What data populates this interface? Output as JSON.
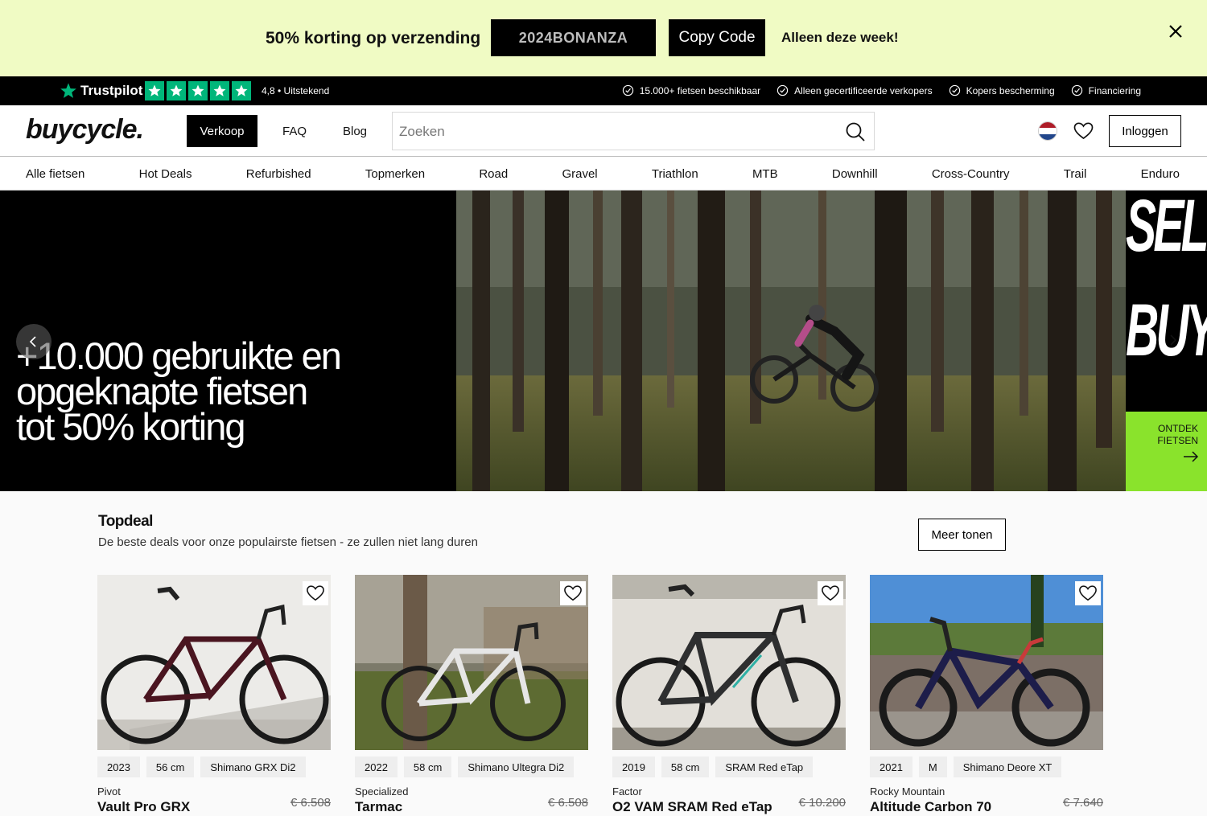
{
  "promo": {
    "text": "50% korting op verzending",
    "code": "2024BONANZA",
    "copy_label": "Copy Code",
    "note": "Alleen deze week!"
  },
  "trustbar": {
    "trustpilot_label": "Trustpilot",
    "rating": "4,8 • Uitstekend",
    "usps": [
      "15.000+ fietsen beschikbaar",
      "Alleen gecertificeerde verkopers",
      "Kopers bescherming",
      "Financiering"
    ]
  },
  "header": {
    "logo": "buycycle.",
    "nav": {
      "sell": "Verkoop",
      "faq": "FAQ",
      "blog": "Blog"
    },
    "search_placeholder": "Zoeken",
    "login": "Inloggen"
  },
  "categories": [
    "Alle fietsen",
    "Hot Deals",
    "Refurbished",
    "Topmerken",
    "Road",
    "Gravel",
    "Triathlon",
    "MTB",
    "Downhill",
    "Cross-Country",
    "Trail",
    "Enduro"
  ],
  "hero": {
    "headline": [
      "+10.000 gebruikte en",
      "opgeknapte fietsen",
      "tot 50% korting"
    ],
    "side_words": [
      "SELL",
      "BUY"
    ],
    "cta": [
      "ONTDEK",
      "FIETSEN"
    ]
  },
  "topdeal": {
    "title": "Topdeal",
    "subtitle": "De beste deals voor onze populairste fietsen - ze zullen niet lang duren",
    "more_label": "Meer tonen",
    "cards": [
      {
        "tags": [
          "2023",
          "56 cm",
          "Shimano GRX Di2"
        ],
        "brand": "Pivot",
        "model": "Vault Pro GRX",
        "old_price": "€ 6.508"
      },
      {
        "tags": [
          "2022",
          "58 cm",
          "Shimano Ultegra Di2"
        ],
        "brand": "Specialized",
        "model": "Tarmac",
        "old_price": "€ 6.508"
      },
      {
        "tags": [
          "2019",
          "58 cm",
          "SRAM Red eTap"
        ],
        "brand": "Factor",
        "model": "O2 VAM SRAM Red eTap",
        "old_price": "€ 10.200"
      },
      {
        "tags": [
          "2021",
          "M",
          "Shimano Deore XT"
        ],
        "brand": "Rocky Mountain",
        "model": "Altitude Carbon 70",
        "old_price": "€ 7.640"
      }
    ]
  },
  "colors": {
    "promo_bg": "#f0fbc4",
    "trustpilot_green": "#00b67a",
    "cta_green": "#8ae32c"
  }
}
